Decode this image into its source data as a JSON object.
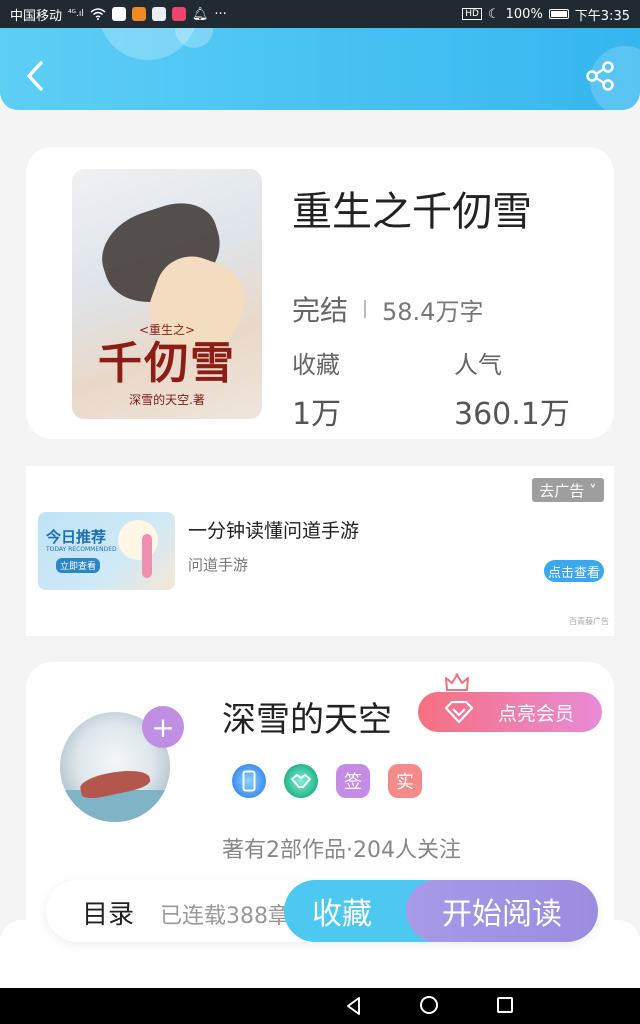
{
  "status_bar": {
    "carrier": "中国移动",
    "signal": "⁴ᴳ.ıl",
    "battery": "100%",
    "time": "下午3:35",
    "more": "···"
  },
  "header": {
    "back_icon": "chevron-left-icon",
    "share_icon": "share-icon"
  },
  "book": {
    "title": "重生之千仞雪",
    "cover": {
      "subtitle": "<重生之>",
      "title": "千仞雪",
      "author": "深雪的天空.著"
    },
    "status": "完结",
    "word_count": "58.4万字",
    "favorites_label": "收藏",
    "favorites_value": "1万",
    "popularity_label": "人气",
    "popularity_value": "360.1万"
  },
  "ad": {
    "close_label": "去广告 ˅",
    "image": {
      "title": "今日推荐",
      "subtitle": "TODAY RECOMMENDED",
      "button": "立即查看"
    },
    "title": "一分钟读懂问道手游",
    "source": "问道手游",
    "cta": "点击查看",
    "mark": "百青藤广告"
  },
  "author": {
    "name": "深雪的天空",
    "vip_button": "点亮会员",
    "follow_icon": "plus-icon",
    "badges": [
      "phone",
      "handshake",
      "签",
      "实"
    ],
    "info": "著有2部作品·204人关注"
  },
  "action_bar": {
    "toc_label": "目录",
    "toc_status": "已连载388章",
    "collect_button": "收藏",
    "read_button": "开始阅读"
  },
  "colors": {
    "header": "#35b6f0",
    "collect": "#4cc8f1",
    "read": "#9b8ce0",
    "vip": "#f5707e"
  }
}
